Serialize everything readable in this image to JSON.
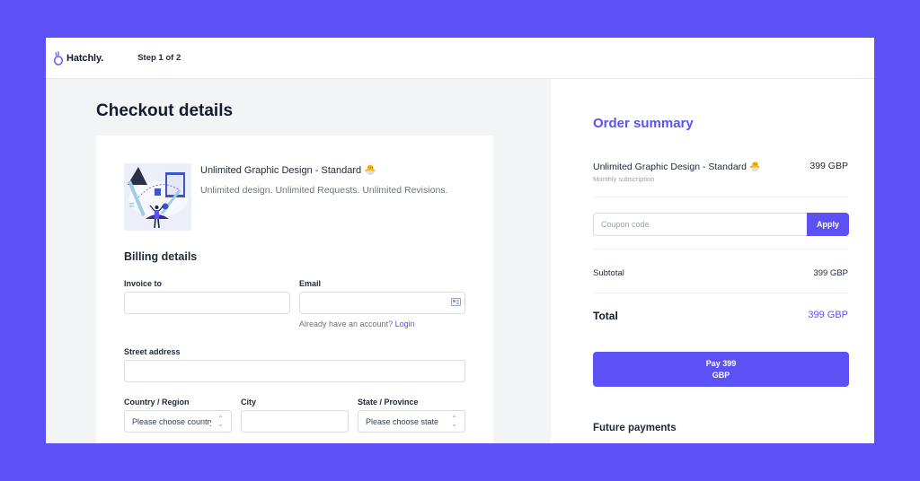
{
  "header": {
    "logo_text": "Hatchly.",
    "step": "Step 1 of 2"
  },
  "checkout": {
    "title": "Checkout details",
    "product": {
      "title": "Unlimited Graphic Design - Standard 🐣",
      "description": "Unlimited design. Unlimited Requests. Unlimited Revisions."
    },
    "billing": {
      "title": "Billing details",
      "invoice_label": "Invoice to",
      "invoice_value": "",
      "email_label": "Email",
      "email_value": "",
      "account_prompt": "Already have an account?",
      "login_link": "Login",
      "street_label": "Street address",
      "street_value": "",
      "country_label": "Country / Region",
      "country_selected": "Please choose country",
      "city_label": "City",
      "city_value": "",
      "state_label": "State / Province",
      "state_selected": "Please choose state"
    }
  },
  "summary": {
    "title": "Order summary",
    "item": {
      "name": "Unlimited Graphic Design - Standard 🐣",
      "subtitle": "Monthly subscription",
      "price": "399 GBP"
    },
    "coupon": {
      "placeholder": "Coupon code",
      "value": "",
      "apply_label": "Apply"
    },
    "subtotal_label": "Subtotal",
    "subtotal_value": "399 GBP",
    "total_label": "Total",
    "total_value": "399 GBP",
    "pay_line1": "Pay 399",
    "pay_line2": "GBP",
    "future_payments": "Future payments"
  },
  "colors": {
    "accent": "#5b51f5",
    "background": "#5b51f5",
    "left_panel": "#f3f4f6"
  }
}
